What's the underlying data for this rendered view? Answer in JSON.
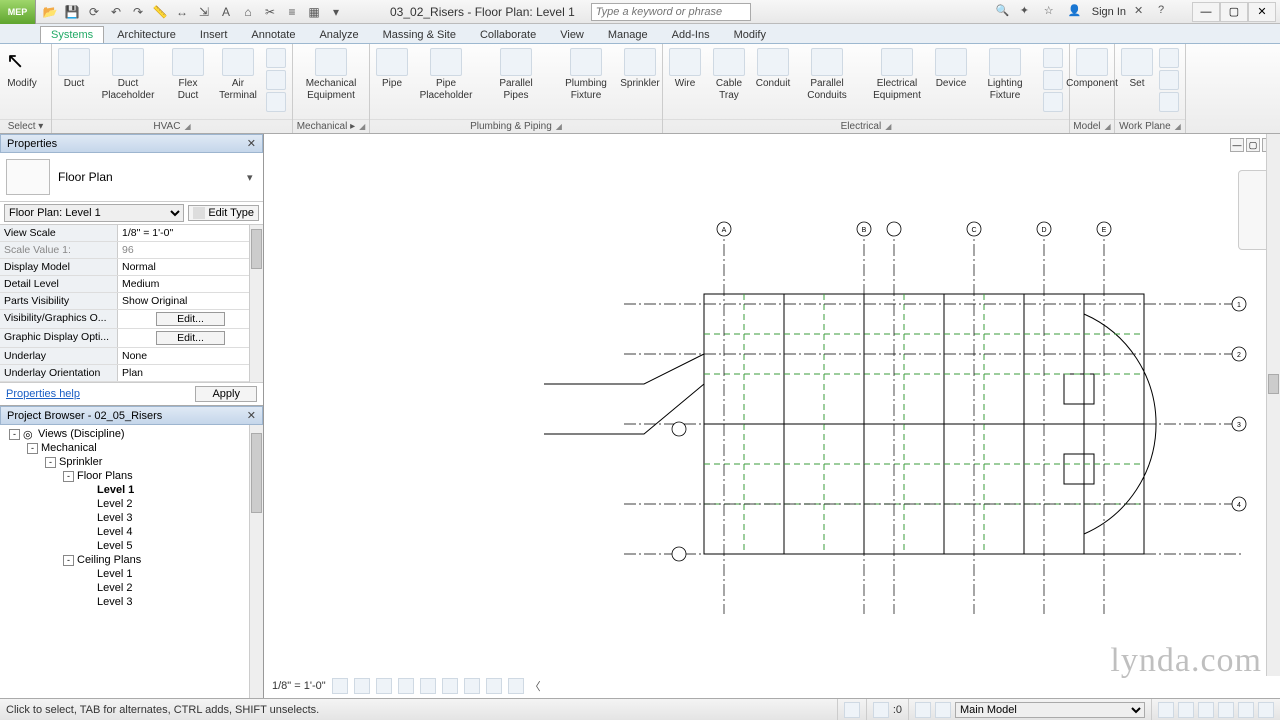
{
  "title": "03_02_Risers - Floor Plan: Level 1",
  "search_placeholder": "Type a keyword or phrase",
  "signin": "Sign In",
  "app_button": "MEP",
  "tabs": [
    "Systems",
    "Architecture",
    "Insert",
    "Annotate",
    "Analyze",
    "Massing & Site",
    "Collaborate",
    "View",
    "Manage",
    "Add-Ins",
    "Modify"
  ],
  "active_tab": 0,
  "ribbon": {
    "select": {
      "modify": "Modify",
      "select_label": "Select ▾"
    },
    "hvac": {
      "label": "HVAC",
      "buttons": [
        {
          "name": "duct",
          "label": "Duct"
        },
        {
          "name": "duct-placeholder",
          "label": "Duct\nPlaceholder"
        },
        {
          "name": "flex-duct",
          "label": "Flex\nDuct"
        },
        {
          "name": "air-terminal",
          "label": "Air\nTerminal"
        }
      ]
    },
    "mechanical": {
      "label": "Mechanical ▸",
      "buttons": [
        {
          "name": "mechanical-equipment",
          "label": "Mechanical\nEquipment"
        }
      ]
    },
    "plumbing": {
      "label": "Plumbing & Piping",
      "buttons": [
        {
          "name": "pipe",
          "label": "Pipe"
        },
        {
          "name": "pipe-placeholder",
          "label": "Pipe\nPlaceholder"
        },
        {
          "name": "parallel-pipes",
          "label": "Parallel\nPipes"
        },
        {
          "name": "plumbing-fixture",
          "label": "Plumbing\nFixture"
        },
        {
          "name": "sprinkler",
          "label": "Sprinkler"
        }
      ]
    },
    "electrical": {
      "label": "Electrical",
      "buttons": [
        {
          "name": "wire",
          "label": "Wire"
        },
        {
          "name": "cable-tray",
          "label": "Cable\nTray"
        },
        {
          "name": "conduit",
          "label": "Conduit"
        },
        {
          "name": "parallel-conduits",
          "label": "Parallel\nConduits"
        },
        {
          "name": "electrical-equipment",
          "label": "Electrical\nEquipment"
        },
        {
          "name": "device",
          "label": "Device"
        },
        {
          "name": "lighting-fixture",
          "label": "Lighting\nFixture"
        }
      ]
    },
    "model": {
      "label": "Model",
      "buttons": [
        {
          "name": "component",
          "label": "Component"
        }
      ]
    },
    "workplane": {
      "label": "Work Plane",
      "buttons": [
        {
          "name": "set",
          "label": "Set"
        }
      ]
    }
  },
  "properties": {
    "title": "Properties",
    "type_name": "Floor Plan",
    "instance": "Floor Plan: Level 1",
    "edit_type": "Edit Type",
    "rows": [
      {
        "k": "View Scale",
        "v": "1/8\" = 1'-0\"",
        "type": "select"
      },
      {
        "k": "Scale Value   1:",
        "v": "96",
        "type": "readonly"
      },
      {
        "k": "Display Model",
        "v": "Normal",
        "type": "text"
      },
      {
        "k": "Detail Level",
        "v": "Medium",
        "type": "text"
      },
      {
        "k": "Parts Visibility",
        "v": "Show Original",
        "type": "text"
      },
      {
        "k": "Visibility/Graphics O...",
        "v": "Edit...",
        "type": "button"
      },
      {
        "k": "Graphic Display Opti...",
        "v": "Edit...",
        "type": "button"
      },
      {
        "k": "Underlay",
        "v": "None",
        "type": "text"
      },
      {
        "k": "Underlay Orientation",
        "v": "Plan",
        "type": "text"
      }
    ],
    "help": "Properties help",
    "apply": "Apply"
  },
  "browser": {
    "title": "Project Browser - 02_05_Risers",
    "tree": [
      {
        "depth": 0,
        "exp": "-",
        "icon": true,
        "label": "Views (Discipline)"
      },
      {
        "depth": 1,
        "exp": "-",
        "label": "Mechanical"
      },
      {
        "depth": 2,
        "exp": "-",
        "label": "Sprinkler"
      },
      {
        "depth": 3,
        "exp": "-",
        "label": "Floor Plans"
      },
      {
        "depth": 4,
        "exp": "",
        "label": "Level 1",
        "bold": true
      },
      {
        "depth": 4,
        "exp": "",
        "label": "Level 2"
      },
      {
        "depth": 4,
        "exp": "",
        "label": "Level 3"
      },
      {
        "depth": 4,
        "exp": "",
        "label": "Level 4"
      },
      {
        "depth": 4,
        "exp": "",
        "label": "Level 5"
      },
      {
        "depth": 3,
        "exp": "-",
        "label": "Ceiling Plans"
      },
      {
        "depth": 4,
        "exp": "",
        "label": "Level 1"
      },
      {
        "depth": 4,
        "exp": "",
        "label": "Level 2"
      },
      {
        "depth": 4,
        "exp": "",
        "label": "Level 3"
      }
    ]
  },
  "view_bar": {
    "scale": "1/8\" = 1'-0\""
  },
  "status": {
    "hint": "Click to select, TAB for alternates, CTRL adds, SHIFT unselects.",
    "filter_count": ":0",
    "workset": "Main Model"
  },
  "watermark": "lynda.com"
}
